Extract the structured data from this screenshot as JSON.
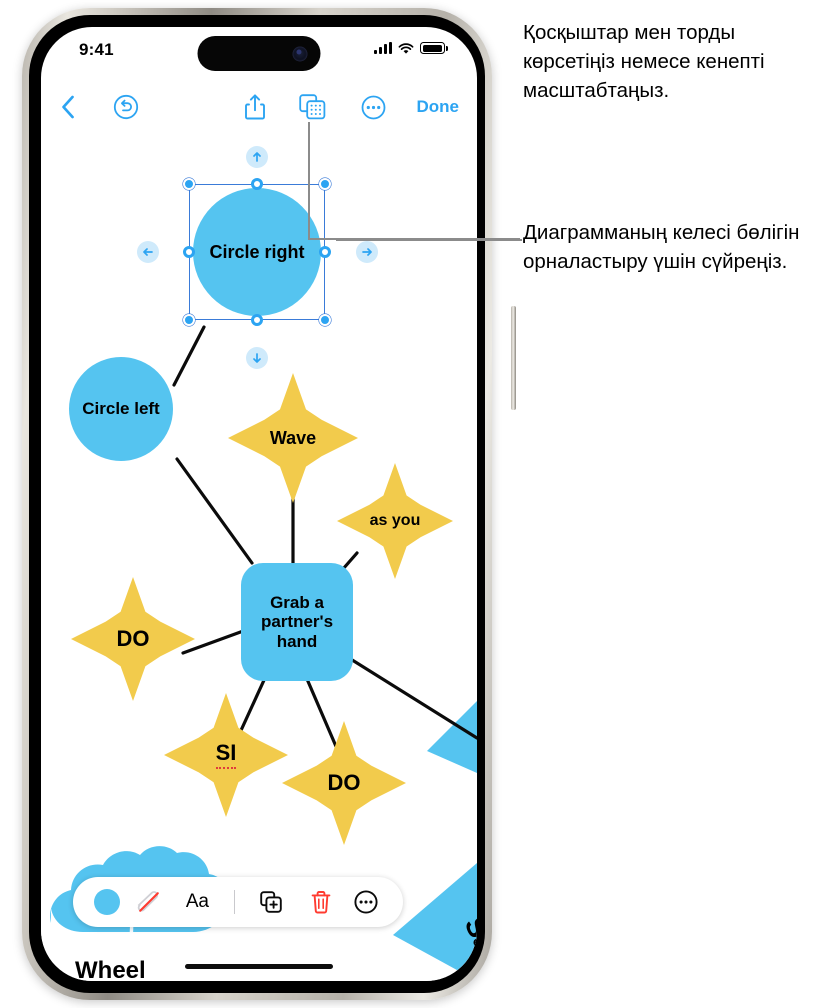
{
  "status_bar": {
    "time": "9:41",
    "cellular_icon": "signal-bars-icon",
    "wifi_icon": "wifi-icon",
    "battery_icon": "battery-icon"
  },
  "toolbar": {
    "back_icon": "chevron-left-icon",
    "undo_icon": "undo-arrow-icon",
    "share_icon": "share-icon",
    "grid_icon": "connectors-grid-icon",
    "more_icon": "ellipsis-circle-icon",
    "done_label": "Done"
  },
  "canvas": {
    "nodes": [
      {
        "id": "circle-right",
        "label": "Circle right",
        "shape": "circle",
        "color": "#55c4f0",
        "selected": true
      },
      {
        "id": "circle-left",
        "label": "Circle left",
        "shape": "circle",
        "color": "#55c4f0",
        "selected": false
      },
      {
        "id": "wave",
        "label": "Wave",
        "shape": "star",
        "color": "#f2cb4c",
        "selected": false
      },
      {
        "id": "as-you",
        "label": "as you",
        "shape": "star",
        "color": "#f2cb4c",
        "selected": false
      },
      {
        "id": "grab-hand",
        "label": "Grab a partner's hand",
        "shape": "rounded-rect",
        "color": "#55c4f0",
        "selected": false
      },
      {
        "id": "do-left",
        "label": "DO",
        "shape": "star",
        "color": "#f2cb4c",
        "selected": false
      },
      {
        "id": "si",
        "label": "SI",
        "shape": "star",
        "color": "#f2cb4c",
        "selected": false
      },
      {
        "id": "do-right",
        "label": "DO",
        "shape": "star",
        "color": "#f2cb4c",
        "selected": false
      }
    ],
    "background_shapes": [
      {
        "id": "cloud-wheel",
        "label": "Wheel",
        "color": "#55c4f0"
      },
      {
        "id": "triangle-say",
        "label": "Say",
        "color": "#55c4f0"
      }
    ],
    "selection": {
      "handle_color": "#2ca4f2",
      "frame_color": "#3a7bd8",
      "arrow_up_icon": "arrow-up-icon",
      "arrow_down_icon": "arrow-down-icon",
      "arrow_left_icon": "arrow-left-icon",
      "arrow_right_icon": "arrow-right-icon"
    }
  },
  "format_bar": {
    "fill_color_label": "fill-color-swatch",
    "fill_color": "#55c4f0",
    "stroke_icon": "no-stroke-icon",
    "text_format_label": "Aa",
    "duplicate_icon": "duplicate-icon",
    "delete_icon": "trash-icon",
    "delete_color": "#ff3b30",
    "more_icon": "ellipsis-circle-icon"
  },
  "callouts": [
    {
      "id": "callout-connectors",
      "text": "Қосқыштар мен торды көрсетіңіз немесе кенепті масштабтаңыз."
    },
    {
      "id": "callout-drag",
      "text": "Диаграмманың келесі бөлігін орналастыру үшін сүйреңіз."
    }
  ]
}
